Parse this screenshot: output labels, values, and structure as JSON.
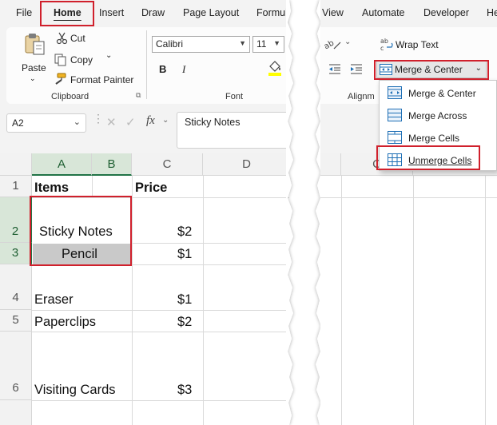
{
  "tabs_left": [
    "File",
    "Home",
    "Insert",
    "Draw",
    "Page Layout",
    "Formul"
  ],
  "tabs_right": [
    "View",
    "Automate",
    "Developer",
    "He"
  ],
  "clipboard": {
    "paste": "Paste",
    "cut": "Cut",
    "copy": "Copy",
    "format_painter": "Format Painter",
    "group_label": "Clipboard"
  },
  "font": {
    "name": "Calibri",
    "size": "11",
    "bold": "B",
    "italic": "I",
    "group_label": "Font"
  },
  "alignment": {
    "wrap_text": "Wrap Text",
    "merge_center": "Merge & Center",
    "group_label": "Alignm"
  },
  "merge_menu": [
    "Merge & Center",
    "Merge Across",
    "Merge Cells",
    "Unmerge Cells"
  ],
  "formula_bar": {
    "name_box": "A2",
    "fx": "fx",
    "content": "Sticky Notes"
  },
  "sheet": {
    "columns_left": [
      "A",
      "B",
      "C",
      "D"
    ],
    "column_right": "C",
    "rows": [
      "1",
      "2",
      "3",
      "4",
      "5",
      "6"
    ],
    "header_items": "Items",
    "header_price": "Price",
    "items": [
      {
        "name": "Sticky Notes",
        "price": "$2"
      },
      {
        "name": "Pencil",
        "price": "$1"
      },
      {
        "name": "Eraser",
        "price": "$1"
      },
      {
        "name": "Paperclips",
        "price": "$2"
      },
      {
        "name": "Visiting Cards",
        "price": "$3"
      }
    ]
  },
  "colors": {
    "highlight_red": "#d0202c",
    "excel_green": "#217346",
    "ribbon_bg": "#f3f3f3",
    "selected_cell": "#c9c9c9"
  }
}
